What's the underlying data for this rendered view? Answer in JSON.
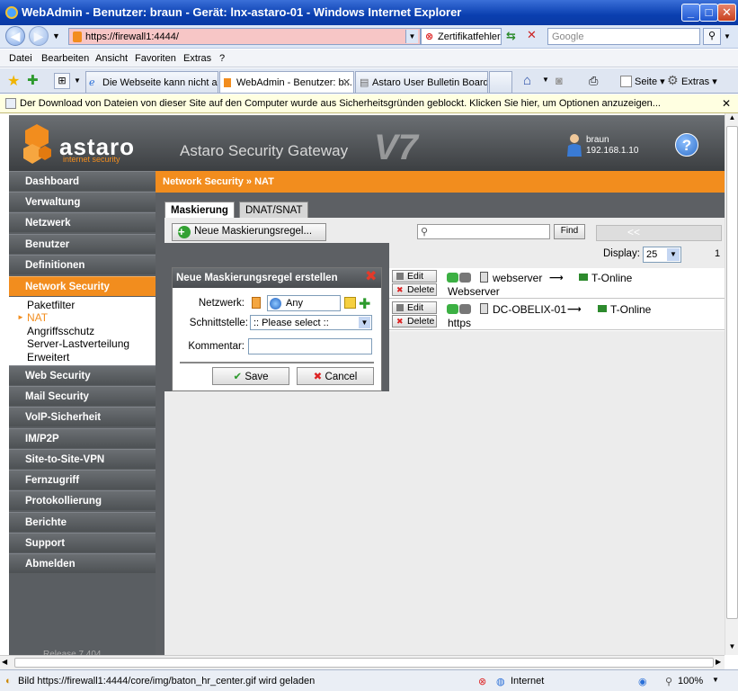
{
  "window": {
    "title": "WebAdmin - Benutzer: braun - Gerät: lnx-astaro-01 - Windows Internet Explorer"
  },
  "browser": {
    "url": "https://firewall1:4444/",
    "cert_error": "Zertifikatfehler",
    "search_placeholder": "Google",
    "menu": [
      "Datei",
      "Bearbeiten",
      "Ansicht",
      "Favoriten",
      "Extras",
      "?"
    ],
    "tabs": [
      {
        "label": "Die Webseite kann nicht ang..."
      },
      {
        "label": "WebAdmin - Benutzer: b..."
      },
      {
        "label": "Astaro User Bulletin Board - ..."
      }
    ],
    "toolbar": {
      "page": "Seite",
      "tools": "Extras"
    },
    "infobar": "Der Download von Dateien von dieser Site auf den Computer wurde aus Sicherheitsgründen geblockt. Klicken Sie hier, um Optionen anzuzeigen...",
    "status": {
      "text": "Bild https://firewall1:4444/core/img/baton_hr_center.gif wird geladen",
      "zone": "Internet",
      "zoom": "100%"
    }
  },
  "app": {
    "brand": "astaro",
    "brand_sub": "internet security",
    "product": "Astaro Security Gateway",
    "version_mark": "V7",
    "user": "braun",
    "ip": "192.168.1.10",
    "help": "?",
    "release": "Release 7.404"
  },
  "sidebar": {
    "items": [
      "Dashboard",
      "Verwaltung",
      "Netzwerk",
      "Benutzer",
      "Definitionen",
      "Network Security",
      "Web Security",
      "Mail Security",
      "VoIP-Sicherheit",
      "IM/P2P",
      "Site-to-Site-VPN",
      "Fernzugriff",
      "Protokollierung",
      "Berichte",
      "Support",
      "Abmelden"
    ],
    "sub": [
      "Paketfilter",
      "NAT",
      "Angriffsschutz",
      "Server-Lastverteilung",
      "Erweitert"
    ]
  },
  "main": {
    "breadcrumb": "Network Security » NAT",
    "tabs": [
      "Maskierung",
      "DNAT/SNAT"
    ],
    "add_button": "Neue Maskierungsregel...",
    "find": "Find",
    "pager": "<<",
    "display_label": "Display:",
    "display_value": "25",
    "page": "1"
  },
  "form": {
    "title": "Neue Maskierungsregel erstellen",
    "network_label": "Netzwerk:",
    "network_value": "Any",
    "interface_label": "Schnittstelle:",
    "interface_value": ":: Please select ::",
    "comment_label": "Kommentar:",
    "save": "Save",
    "cancel": "Cancel"
  },
  "rules": [
    {
      "edit": "Edit",
      "delete": "Delete",
      "network": "webserver",
      "interface": "T-Online",
      "comment": "Webserver"
    },
    {
      "edit": "Edit",
      "delete": "Delete",
      "network": "DC-OBELIX-01",
      "interface": "T-Online",
      "comment": "https"
    }
  ],
  "colors": {
    "accent": "#f28d1e",
    "sidebar": "#5a5e62",
    "enabled": "#3cb043"
  }
}
